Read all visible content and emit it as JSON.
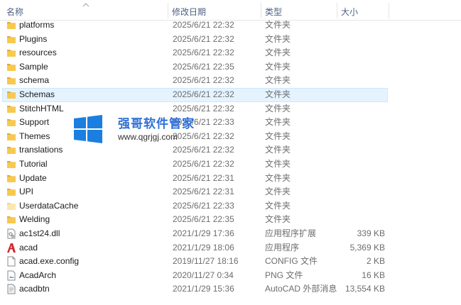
{
  "columns": {
    "name": "名称",
    "date": "修改日期",
    "type": "类型",
    "size": "大小"
  },
  "files": [
    {
      "name": "platforms",
      "date": "2025/6/21 22:32",
      "type": "文件夹",
      "size": "",
      "icon": "folder-icon"
    },
    {
      "name": "Plugins",
      "date": "2025/6/21 22:32",
      "type": "文件夹",
      "size": "",
      "icon": "folder-icon"
    },
    {
      "name": "resources",
      "date": "2025/6/21 22:32",
      "type": "文件夹",
      "size": "",
      "icon": "folder-icon"
    },
    {
      "name": "Sample",
      "date": "2025/6/21 22:35",
      "type": "文件夹",
      "size": "",
      "icon": "folder-icon"
    },
    {
      "name": "schema",
      "date": "2025/6/21 22:32",
      "type": "文件夹",
      "size": "",
      "icon": "folder-icon"
    },
    {
      "name": "Schemas",
      "date": "2025/6/21 22:32",
      "type": "文件夹",
      "size": "",
      "icon": "folder-icon",
      "selected": true
    },
    {
      "name": "StitchHTML",
      "date": "2025/6/21 22:32",
      "type": "文件夹",
      "size": "",
      "icon": "folder-icon"
    },
    {
      "name": "Support",
      "date": "2025/6/21 22:33",
      "type": "文件夹",
      "size": "",
      "icon": "folder-icon"
    },
    {
      "name": "Themes",
      "date": "2025/6/21 22:32",
      "type": "文件夹",
      "size": "",
      "icon": "folder-icon"
    },
    {
      "name": "translations",
      "date": "2025/6/21 22:32",
      "type": "文件夹",
      "size": "",
      "icon": "folder-icon"
    },
    {
      "name": "Tutorial",
      "date": "2025/6/21 22:32",
      "type": "文件夹",
      "size": "",
      "icon": "folder-icon"
    },
    {
      "name": "Update",
      "date": "2025/6/21 22:31",
      "type": "文件夹",
      "size": "",
      "icon": "folder-icon"
    },
    {
      "name": "UPI",
      "date": "2025/6/21 22:31",
      "type": "文件夹",
      "size": "",
      "icon": "folder-icon"
    },
    {
      "name": "UserdataCache",
      "date": "2025/6/21 22:33",
      "type": "文件夹",
      "size": "",
      "icon": "folder-light-icon"
    },
    {
      "name": "Welding",
      "date": "2025/6/21 22:35",
      "type": "文件夹",
      "size": "",
      "icon": "folder-icon"
    },
    {
      "name": "ac1st24.dll",
      "date": "2021/1/29 17:36",
      "type": "应用程序扩展",
      "size": "339 KB",
      "icon": "dll-file-icon"
    },
    {
      "name": "acad",
      "date": "2021/1/29 18:06",
      "type": "应用程序",
      "size": "5,369 KB",
      "icon": "autocad-app-icon"
    },
    {
      "name": "acad.exe.config",
      "date": "2019/11/27 18:16",
      "type": "CONFIG 文件",
      "size": "2 KB",
      "icon": "config-file-icon"
    },
    {
      "name": "AcadArch",
      "date": "2020/11/27 0:34",
      "type": "PNG 文件",
      "size": "16 KB",
      "icon": "png-file-icon"
    },
    {
      "name": "acadbtn",
      "date": "2021/1/29 15:36",
      "type": "AutoCAD 外部消息",
      "size": "13,554 KB",
      "icon": "message-file-icon"
    }
  ],
  "watermark": {
    "title": "强哥软件管家",
    "url": "www.qgrjgj.com"
  },
  "colors": {
    "header_text": "#4d6082",
    "selection_bg": "#e5f3ff",
    "folder": "#f2c14e",
    "autocad_red": "#d6232a",
    "windows_blue": "#1a7fe0"
  }
}
